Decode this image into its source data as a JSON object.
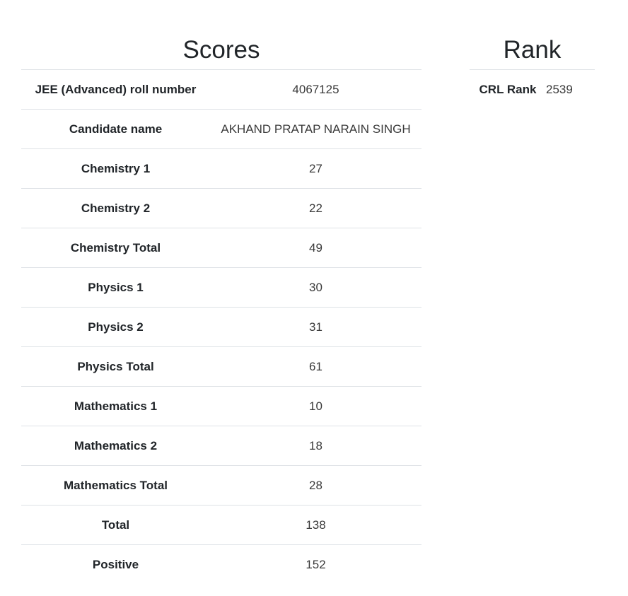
{
  "scores": {
    "title": "Scores",
    "rows": [
      {
        "label": "JEE (Advanced) roll number",
        "value": "4067125"
      },
      {
        "label": "Candidate name",
        "value": "AKHAND PRATAP NARAIN SINGH"
      },
      {
        "label": "Chemistry 1",
        "value": "27"
      },
      {
        "label": "Chemistry 2",
        "value": "22"
      },
      {
        "label": "Chemistry Total",
        "value": "49"
      },
      {
        "label": "Physics 1",
        "value": "30"
      },
      {
        "label": "Physics 2",
        "value": "31"
      },
      {
        "label": "Physics Total",
        "value": "61"
      },
      {
        "label": "Mathematics 1",
        "value": "10"
      },
      {
        "label": "Mathematics 2",
        "value": "18"
      },
      {
        "label": "Mathematics Total",
        "value": "28"
      },
      {
        "label": "Total",
        "value": "138"
      },
      {
        "label": "Positive",
        "value": "152"
      }
    ]
  },
  "rank": {
    "title": "Rank",
    "rows": [
      {
        "label": "CRL Rank",
        "value": "2539"
      }
    ]
  }
}
